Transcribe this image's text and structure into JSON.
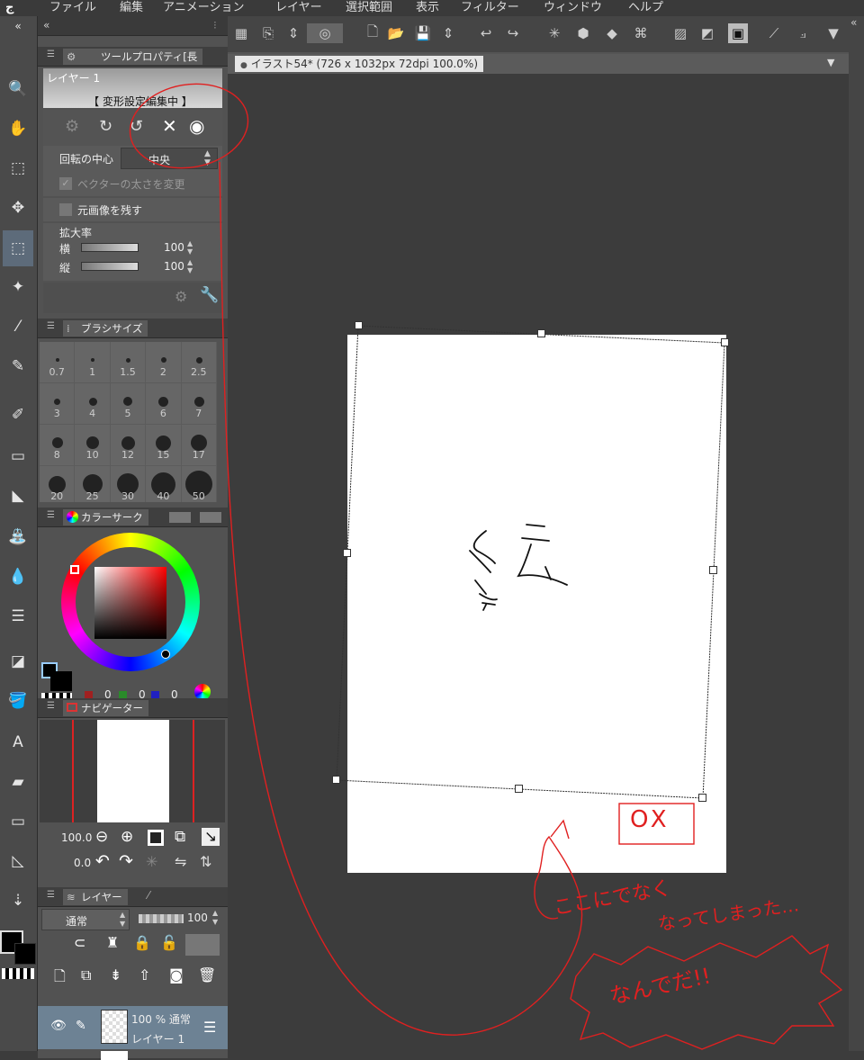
{
  "menu": [
    "ファイル",
    "編集",
    "アニメーション",
    "レイヤー",
    "選択範囲",
    "表示",
    "フィルター",
    "ウィンドウ",
    "ヘルプ"
  ],
  "document_tab": "イラスト54* (726 x 1032px 72dpi 100.0%)",
  "tool_property": {
    "tab": "ツールプロパティ[長",
    "layer_name": "レイヤー 1",
    "status": "【 変形設定編集中 】",
    "rotation_center_label": "回転の中心",
    "rotation_center_value": "中央",
    "vector_width_label": "ベクターの太さを変更",
    "keep_original_label": "元画像を残す",
    "scale_label": "拡大率",
    "horizontal_label": "横",
    "vertical_label": "縦",
    "horizontal_value": "100",
    "vertical_value": "100"
  },
  "brush_size": {
    "tab": "ブラシサイズ",
    "sizes": [
      "0.7",
      "1",
      "1.5",
      "2",
      "2.5",
      "3",
      "4",
      "5",
      "6",
      "7",
      "8",
      "10",
      "12",
      "15",
      "17",
      "20",
      "25",
      "30",
      "40",
      "50"
    ]
  },
  "color": {
    "tab": "カラーサーク",
    "r": "0",
    "g": "0",
    "b": "0",
    "main_color": "#000000"
  },
  "navigator": {
    "tab": "ナビゲーター",
    "zoom": "100.0",
    "rotation": "0.0"
  },
  "layer_panel": {
    "tab": "レイヤー",
    "blend_mode": "通常",
    "opacity": "100",
    "layer_opacity_mode": "100 % 通常",
    "layer_name": "レイヤー 1"
  },
  "annotation": {
    "stamp": "OX",
    "note1": "ここにでなく",
    "note2": "なってしまった…",
    "note3": "なんでだ!!"
  },
  "canvas_drawing": "絵",
  "colors": {
    "accent_red": "#e02020",
    "selected_tool": "#5d6b7a",
    "panel_bg": "#525252"
  }
}
